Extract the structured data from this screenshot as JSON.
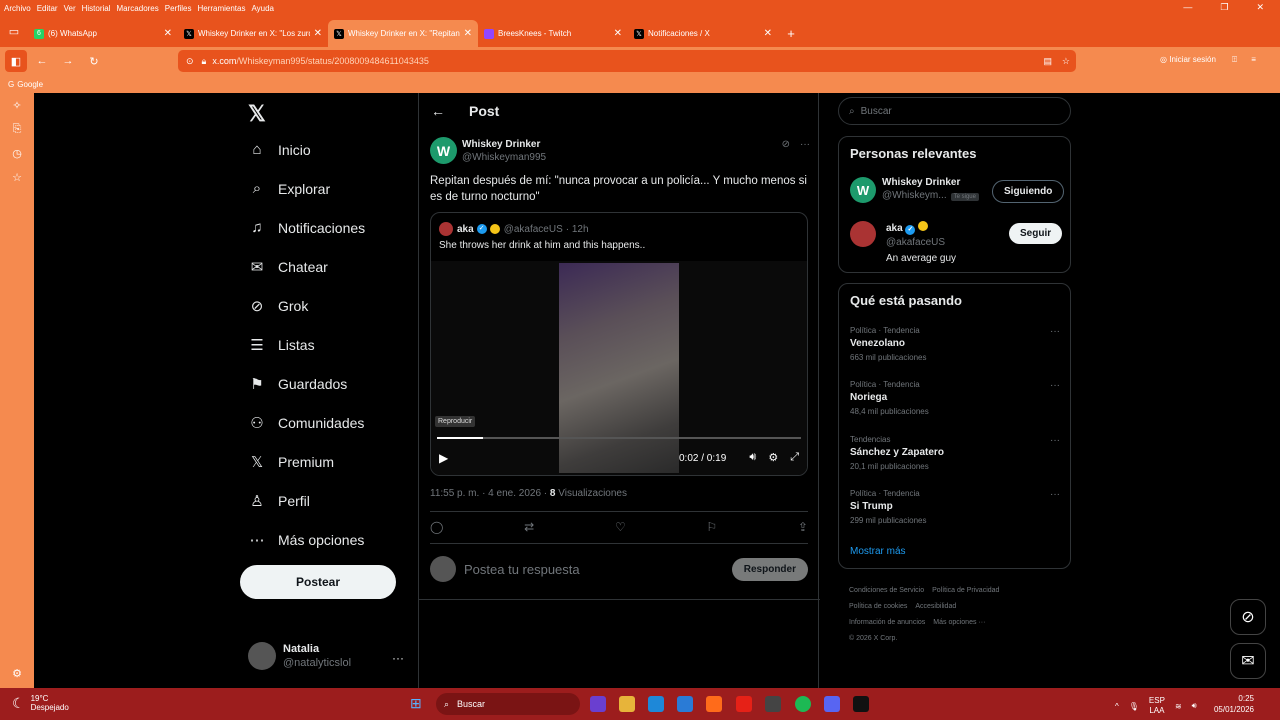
{
  "browser": {
    "menu": [
      "Archivo",
      "Editar",
      "Ver",
      "Historial",
      "Marcadores",
      "Perfiles",
      "Herramientas",
      "Ayuda"
    ],
    "tabs": [
      {
        "title": "(6) WhatsApp",
        "badge": "6",
        "active": false
      },
      {
        "title": "Whiskey Drinker en X: \"Los zurd",
        "active": false
      },
      {
        "title": "Whiskey Drinker en X: \"Repitan",
        "active": true
      },
      {
        "title": "BreesKnees - Twitch",
        "active": false
      },
      {
        "title": "Notificaciones / X",
        "active": false
      }
    ],
    "url_host": "x.com",
    "url_path": "/Whiskeyman995/status/2008009484611043435",
    "signin_label": "Iniciar sesión",
    "bookmark": "Google"
  },
  "nav": {
    "logo": "𝕏",
    "items": [
      {
        "label": "Inicio",
        "icon": "⌂"
      },
      {
        "label": "Explorar",
        "icon": "⌕"
      },
      {
        "label": "Notificaciones",
        "icon": "♫"
      },
      {
        "label": "Chatear",
        "icon": "✉"
      },
      {
        "label": "Grok",
        "icon": "⊘"
      },
      {
        "label": "Listas",
        "icon": "☰"
      },
      {
        "label": "Guardados",
        "icon": "⚑"
      },
      {
        "label": "Comunidades",
        "icon": "⚇"
      },
      {
        "label": "Premium",
        "icon": "𝕏"
      },
      {
        "label": "Perfil",
        "icon": "♙"
      },
      {
        "label": "Más opciones",
        "icon": "⋯"
      }
    ],
    "post_button": "Postear",
    "account": {
      "name": "Natalia",
      "handle": "@natalyticslol"
    }
  },
  "post": {
    "header": "Post",
    "author_name": "Whiskey Drinker",
    "author_handle": "@Whiskeyman995",
    "avatar_letter": "W",
    "text": "Repitan después de mí: \"nunca provocar a un policía... Y mucho menos si es de turno nocturno\"",
    "quote": {
      "name": "aka",
      "handle": "@akafaceUS",
      "time": "· 12h",
      "text": "She throws her drink at him and this happens..",
      "video": {
        "tooltip": "Reproducir",
        "time": "0:02 / 0:19",
        "progress_pct": 12.6
      }
    },
    "timestamp": "11:55 p. m. · 4 ene. 2026 · ",
    "views_count": "8",
    "views_label": " Visualizaciones",
    "reply_placeholder": "Postea tu respuesta",
    "reply_button": "Responder"
  },
  "sidebar": {
    "search_placeholder": "Buscar",
    "relevant_title": "Personas relevantes",
    "people": [
      {
        "name": "Whiskey Drinker",
        "handle": "@Whiskeym...",
        "tag": "Te sigue",
        "button": "Siguiendo",
        "avatar_letter": "W"
      },
      {
        "name": "aka",
        "handle": "@akafaceUS",
        "bio": "An average guy",
        "button": "Seguir"
      }
    ],
    "trends_title": "Qué está pasando",
    "trends": [
      {
        "context": "Política · Tendencia",
        "title": "Venezolano",
        "count": "663 mil publicaciones"
      },
      {
        "context": "Política · Tendencia",
        "title": "Noriega",
        "count": "48,4 mil publicaciones"
      },
      {
        "context": "Tendencias",
        "title": "Sánchez y Zapatero",
        "count": "20,1 mil publicaciones"
      },
      {
        "context": "Política · Tendencia",
        "title": "Si Trump",
        "count": "299 mil publicaciones"
      }
    ],
    "show_more": "Mostrar más",
    "footer": [
      "Condiciones de Servicio",
      "Política de Privacidad",
      "Política de cookies",
      "Accesibilidad",
      "Información de anuncios",
      "Más opciones ···",
      "© 2026 X Corp."
    ]
  },
  "taskbar": {
    "temp": "19°C",
    "weather": "Despejado",
    "search": "Buscar",
    "lang1": "ESP",
    "lang2": "LAA",
    "time": "0:25",
    "date": "05/01/2026"
  },
  "colors": {
    "accent": "#1d9bf0",
    "browser": "#e8531d",
    "taskbar": "#9c1d1d"
  }
}
